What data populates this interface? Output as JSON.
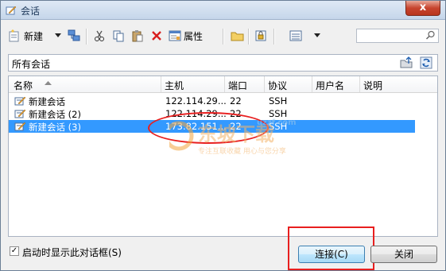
{
  "window": {
    "title": "会话",
    "close_symbol": "x"
  },
  "toolbar": {
    "new_label": "新建",
    "properties_label": "属性",
    "search_placeholder": ""
  },
  "path_bar": {
    "text": "所有会话"
  },
  "columns": [
    "名称",
    "主机",
    "端口",
    "协议",
    "用户名",
    "说明"
  ],
  "sessions": [
    {
      "name": "新建会话",
      "host": "122.114.29...",
      "port": "22",
      "protocol": "SSH",
      "user": "",
      "desc": ""
    },
    {
      "name": "新建会话 (2)",
      "host": "122.114.29...",
      "port": "22",
      "protocol": "SSH",
      "user": "",
      "desc": ""
    },
    {
      "name": "新建会话 (3)",
      "host": "173.82.151...",
      "port": "22",
      "protocol": "SSH",
      "user": "",
      "desc": ""
    }
  ],
  "selected_row": 2,
  "footer": {
    "show_on_startup_label": "启动时显示此对话框(S)",
    "show_on_startup_checked": true,
    "connect_label": "连接(C)",
    "close_label": "关闭"
  },
  "watermark": {
    "text_main": "东坡下载",
    "text_sub": "专注互联收藏 用心与您分享",
    "site": "uzzf.com"
  },
  "colors": {
    "selection": "#3399ff",
    "highlight": "#e81f1f"
  }
}
